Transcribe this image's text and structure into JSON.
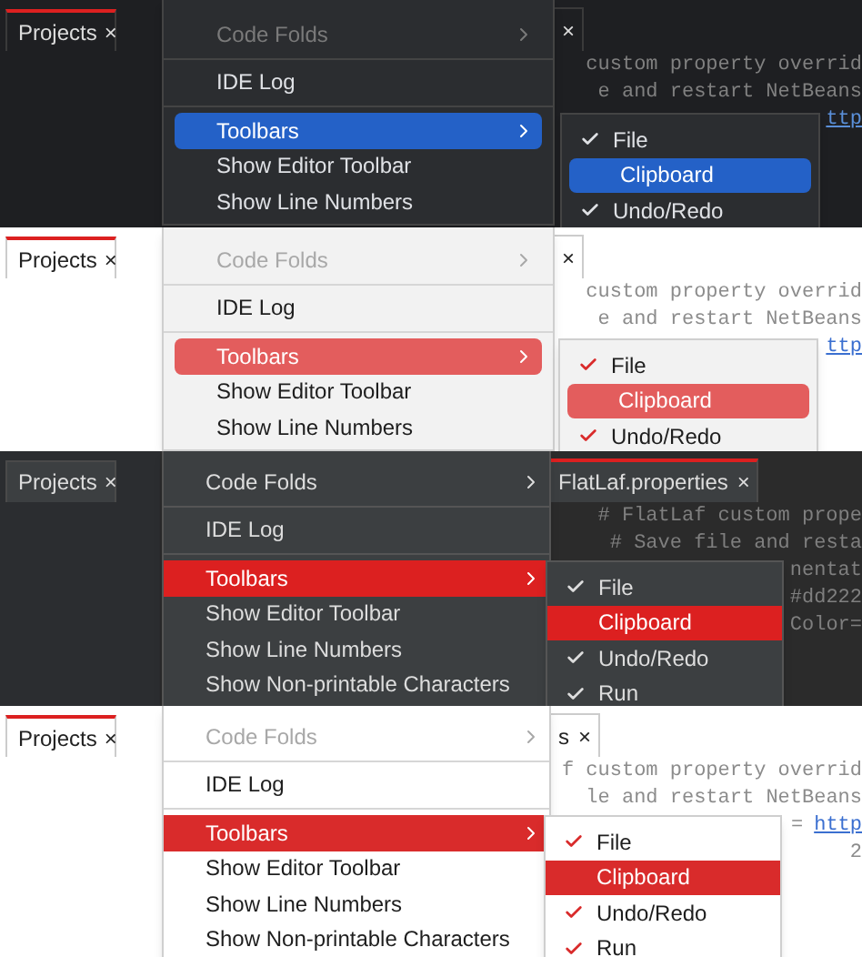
{
  "panels": [
    {
      "kind": "dark-blue",
      "projects_tab": {
        "label": "Projects",
        "close": "×",
        "selected": true
      },
      "editor_tab": {
        "close": "×",
        "selected": false
      },
      "code_lines": [
        [
          {
            "text": "custom property overrid",
            "kind": "comment"
          }
        ],
        [
          {
            "text": "e and restart NetBeans",
            "kind": "comment"
          }
        ],
        [
          {
            "text": "ttp",
            "kind": "link"
          }
        ]
      ],
      "menu": [
        {
          "kind": "item",
          "label": "Code Folds",
          "disabled": true,
          "submenu": true,
          "selected": false
        },
        {
          "kind": "separator"
        },
        {
          "kind": "item",
          "label": "IDE Log",
          "disabled": false,
          "submenu": false,
          "selected": false
        },
        {
          "kind": "separator"
        },
        {
          "kind": "item",
          "label": "Toolbars",
          "disabled": false,
          "submenu": true,
          "selected": true
        },
        {
          "kind": "item",
          "label": "Show Editor Toolbar",
          "disabled": false,
          "submenu": false,
          "selected": false
        },
        {
          "kind": "item",
          "label": "Show Line Numbers",
          "disabled": false,
          "submenu": false,
          "selected": false
        }
      ],
      "submenu": [
        {
          "label": "File",
          "checked": true,
          "selected": false
        },
        {
          "label": "Clipboard",
          "checked": false,
          "selected": true
        },
        {
          "label": "Undo/Redo",
          "checked": true,
          "selected": false
        }
      ]
    },
    {
      "kind": "light-coral",
      "projects_tab": {
        "label": "Projects",
        "close": "×",
        "selected": true
      },
      "editor_tab": {
        "close": "×",
        "selected": false
      },
      "code_lines": [
        [
          {
            "text": "custom property overrid",
            "kind": "comment"
          }
        ],
        [
          {
            "text": "e and restart NetBeans",
            "kind": "comment"
          }
        ],
        [
          {
            "text": "ttp",
            "kind": "link"
          }
        ]
      ],
      "menu": [
        {
          "kind": "item",
          "label": "Code Folds",
          "disabled": true,
          "submenu": true,
          "selected": false
        },
        {
          "kind": "separator"
        },
        {
          "kind": "item",
          "label": "IDE Log",
          "disabled": false,
          "submenu": false,
          "selected": false
        },
        {
          "kind": "separator"
        },
        {
          "kind": "item",
          "label": "Toolbars",
          "disabled": false,
          "submenu": true,
          "selected": true
        },
        {
          "kind": "item",
          "label": "Show Editor Toolbar",
          "disabled": false,
          "submenu": false,
          "selected": false
        },
        {
          "kind": "item",
          "label": "Show Line Numbers",
          "disabled": false,
          "submenu": false,
          "selected": false
        }
      ],
      "submenu": [
        {
          "label": "File",
          "checked": true,
          "selected": false
        },
        {
          "label": "Clipboard",
          "checked": false,
          "selected": true
        },
        {
          "label": "Undo/Redo",
          "checked": true,
          "selected": false
        }
      ]
    },
    {
      "kind": "dark-red",
      "projects_tab": {
        "label": "Projects",
        "close": "×",
        "selected": false
      },
      "editor_tab": {
        "label": "FlatLaf.properties",
        "close": "×",
        "selected": true
      },
      "code_lines": [
        [
          {
            "text": "# FlatLaf custom prope",
            "kind": "comment"
          }
        ],
        [
          {
            "text": "# Save file and resta",
            "kind": "comment"
          }
        ],
        [
          {
            "text": "nentat",
            "kind": "comment"
          }
        ],
        [
          {
            "text": "#dd222",
            "kind": "comment"
          }
        ],
        [
          {
            "text": "Color=",
            "kind": "comment"
          }
        ]
      ],
      "menu": [
        {
          "kind": "item",
          "label": "Code Folds",
          "disabled": false,
          "submenu": true,
          "selected": false
        },
        {
          "kind": "separator"
        },
        {
          "kind": "item",
          "label": "IDE Log",
          "disabled": false,
          "submenu": false,
          "selected": false
        },
        {
          "kind": "separator"
        },
        {
          "kind": "item",
          "label": "Toolbars",
          "disabled": false,
          "submenu": true,
          "selected": true
        },
        {
          "kind": "item",
          "label": "Show Editor Toolbar",
          "disabled": false,
          "submenu": false,
          "selected": false
        },
        {
          "kind": "item",
          "label": "Show Line Numbers",
          "disabled": false,
          "submenu": false,
          "selected": false
        },
        {
          "kind": "item",
          "label": "Show Non-printable Characters",
          "disabled": false,
          "submenu": false,
          "selected": false
        }
      ],
      "submenu": [
        {
          "label": "File",
          "checked": true,
          "selected": false
        },
        {
          "label": "Clipboard",
          "checked": false,
          "selected": true
        },
        {
          "label": "Undo/Redo",
          "checked": true,
          "selected": false
        },
        {
          "label": "Run",
          "checked": true,
          "selected": false
        }
      ]
    },
    {
      "kind": "light-red",
      "projects_tab": {
        "label": "Projects",
        "close": "×",
        "selected": true
      },
      "editor_tab": {
        "label": "s",
        "close": "×",
        "selected": false
      },
      "code_lines": [
        [
          {
            "text": "f custom property overrid",
            "kind": "comment"
          }
        ],
        [
          {
            "text": "le and restart NetBeans",
            "kind": "comment"
          }
        ],
        [
          {
            "text": "=",
            "kind": "comment"
          },
          {
            "text": "http",
            "kind": "link"
          }
        ],
        [
          {
            "text": "2",
            "kind": "comment"
          }
        ]
      ],
      "menu": [
        {
          "kind": "item",
          "label": "Code Folds",
          "disabled": true,
          "submenu": true,
          "selected": false
        },
        {
          "kind": "separator"
        },
        {
          "kind": "item",
          "label": "IDE Log",
          "disabled": false,
          "submenu": false,
          "selected": false
        },
        {
          "kind": "separator"
        },
        {
          "kind": "item",
          "label": "Toolbars",
          "disabled": false,
          "submenu": true,
          "selected": true
        },
        {
          "kind": "item",
          "label": "Show Editor Toolbar",
          "disabled": false,
          "submenu": false,
          "selected": false
        },
        {
          "kind": "item",
          "label": "Show Line Numbers",
          "disabled": false,
          "submenu": false,
          "selected": false
        },
        {
          "kind": "item",
          "label": "Show Non-printable Characters",
          "disabled": false,
          "submenu": false,
          "selected": false
        }
      ],
      "submenu": [
        {
          "label": "File",
          "checked": true,
          "selected": false
        },
        {
          "label": "Clipboard",
          "checked": false,
          "selected": true
        },
        {
          "label": "Undo/Redo",
          "checked": true,
          "selected": false
        },
        {
          "label": "Run",
          "checked": true,
          "selected": false
        }
      ]
    }
  ]
}
